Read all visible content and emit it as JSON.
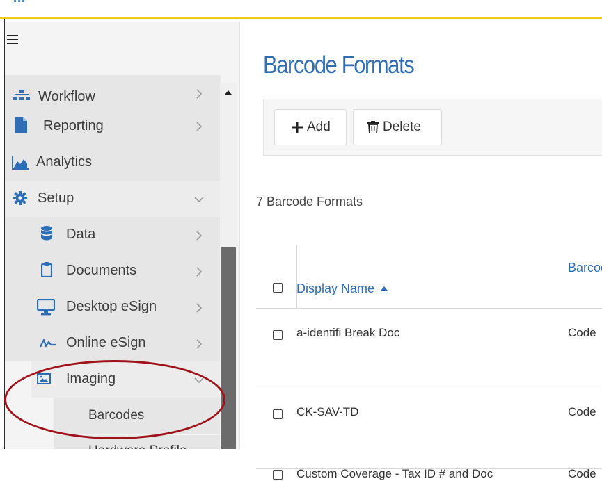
{
  "sidebar": {
    "items": [
      {
        "label": "Workflow"
      },
      {
        "label": "Reporting"
      },
      {
        "label": "Analytics"
      },
      {
        "label": "Setup"
      },
      {
        "label": "Data"
      },
      {
        "label": "Documents"
      },
      {
        "label": "Desktop eSign"
      },
      {
        "label": "Online eSign"
      },
      {
        "label": "Imaging"
      },
      {
        "label": "Barcodes"
      },
      {
        "label": "Hardware Profile"
      }
    ]
  },
  "main": {
    "title": "Barcode Formats",
    "toolbar": {
      "add_label": "Add",
      "delete_label": "Delete"
    },
    "count_text": "7 Barcode Formats",
    "table": {
      "headers": {
        "display_name": "Display Name",
        "barcode_type": "Barcode Type"
      },
      "rows": [
        {
          "display_name": "a-identifi Break Doc",
          "barcode_type": "Code"
        },
        {
          "display_name": "CK-SAV-TD",
          "barcode_type": "Code"
        },
        {
          "display_name": "Custom Coverage - Tax ID # and Doc",
          "barcode_type": "Code"
        }
      ]
    }
  },
  "colors": {
    "accent": "#2f6eb5",
    "topbar_border": "#f2c81e",
    "annotation": "#a1131b"
  }
}
